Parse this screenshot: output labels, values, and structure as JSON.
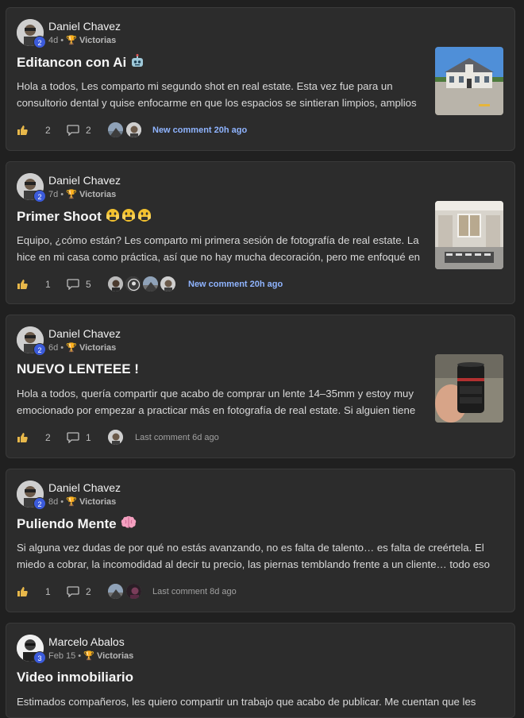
{
  "posts": [
    {
      "author": "Daniel Chavez",
      "level": "2",
      "age": "4d",
      "group": "Victorias",
      "title": "Editancon con Ai",
      "title_emoji": "robot",
      "body": "Hola a todos, Les comparto mi segundo shot en real estate. Esta vez fue para un consultorio dental y quise enfocarme en que los espacios se sintieran limpios, amplios",
      "likes": "2",
      "comments": "2",
      "last_comment": "New comment 20h ago",
      "thumbnail": "house-exterior"
    },
    {
      "author": "Daniel Chavez",
      "level": "2",
      "age": "7d",
      "group": "Victorias",
      "title": "Primer Shoot",
      "title_emoji": "scared-faces",
      "body": "Equipo, ¿cómo están? Les comparto mi primera sesión de fotografía de real estate. La hice en mi casa como práctica, así que no hay mucha decoración, pero me enfoqué en",
      "likes": "1",
      "comments": "5",
      "last_comment": "New comment 20h ago",
      "thumbnail": "interior-room"
    },
    {
      "author": "Daniel Chavez",
      "level": "2",
      "age": "6d",
      "group": "Victorias",
      "title": "NUEVO LENTEEE !",
      "title_emoji": "",
      "body": "Hola a todos, quería compartir que acabo de comprar un lente 14–35mm y estoy muy emocionado por empezar a practicar más en fotografía de real estate. Si alguien tiene",
      "likes": "2",
      "comments": "1",
      "last_comment": "Last comment 6d ago",
      "thumbnail": "camera-lens"
    },
    {
      "author": "Daniel Chavez",
      "level": "2",
      "age": "8d",
      "group": "Victorias",
      "title": "Puliendo Mente",
      "title_emoji": "brain",
      "body": "Si alguna vez dudas de por qué no estás avanzando, no es falta de talento… es falta de creértela. El miedo a cobrar, la incomodidad al decir tu precio, las piernas temblando frente a un cliente… todo eso",
      "likes": "1",
      "comments": "2",
      "last_comment": "Last comment 8d ago",
      "thumbnail": ""
    },
    {
      "author": "Marcelo Abalos",
      "level": "3",
      "age": "Feb 15",
      "group": "Victorias",
      "title": "Video inmobiliario",
      "title_emoji": "",
      "body": "Estimados compañeros, les quiero compartir un trabajo que acabo de publicar. Me cuentan que les",
      "likes": "",
      "comments": "",
      "last_comment": "",
      "thumbnail": ""
    }
  ],
  "colors": {
    "background": "#202020",
    "card": "#2c2c2c",
    "level_badge": "#3b5bdb",
    "new_comment": "#8fb4ff",
    "trophy": "#e8a93b"
  }
}
